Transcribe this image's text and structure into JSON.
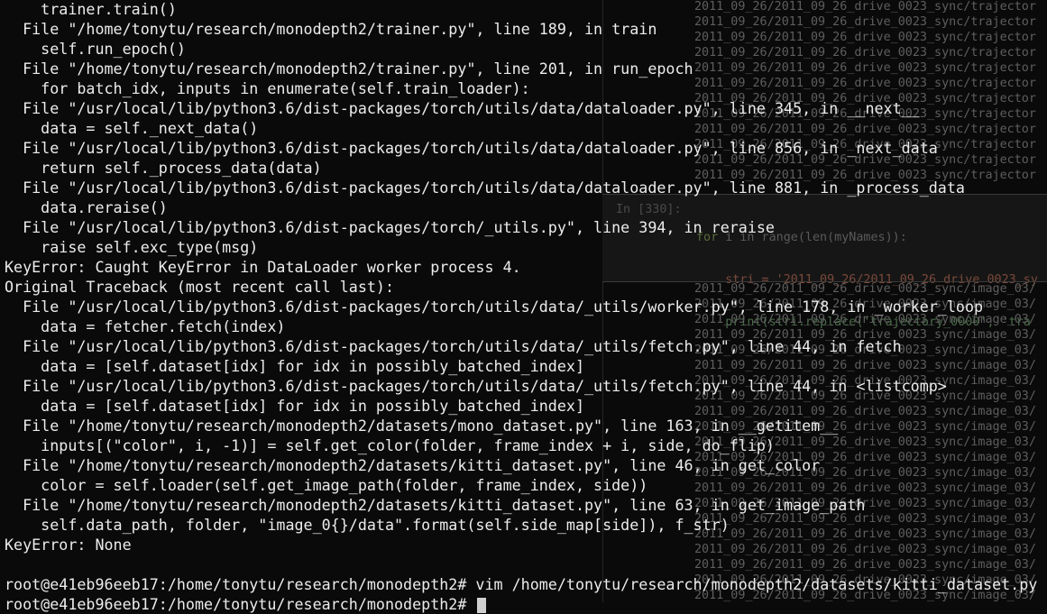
{
  "background_window": {
    "upper_lines": [
      "2011_09_26/2011_09_26_drive_0023_sync/trajector",
      "2011_09_26/2011_09_26_drive_0023_sync/trajector",
      "2011_09_26/2011_09_26_drive_0023_sync/trajector",
      "2011_09_26/2011_09_26_drive_0023_sync/trajector",
      "2011_09_26/2011_09_26_drive_0023_sync/trajector",
      "2011_09_26/2011_09_26_drive_0023_sync/trajector",
      "2011_09_26/2011_09_26_drive_0023_sync/trajector",
      "2011_09_26/2011_09_26_drive_0023_sync/trajector",
      "2011_09_26/2011_09_26_drive_0023_sync/trajector",
      "2011_09_26/2011_09_26_drive_0023_sync/trajector",
      "2011_09_26/2011_09_26_drive_0023_sync/trajector",
      "2011_09_26/2011_09_26_drive_0023_sync/trajector"
    ],
    "cell_prompt": "In [330]:",
    "code_line_1_kw": "for",
    "code_line_1_rest": " i in range(len(myNames)):",
    "code_line_2": "    stri = '2011_09_26/2011_09_26_drive_0023_sy",
    "code_line_3": "    print(stri.replace('trajectory_0000', 'tra",
    "lower_lines": [
      "2011_09_26/2011_09_26_drive_0023_sync/image_03/",
      "2011_09_26/2011_09_26_drive_0023_sync/image_03/",
      "2011_09_26/2011_09_26_drive_0023_sync/image_03/",
      "2011_09_26/2011_09_26_drive_0023_sync/image_03/",
      "2011_09_26/2011_09_26_drive_0023_sync/image_03/",
      "2011_09_26/2011_09_26_drive_0023_sync/image_03/",
      "2011_09_26/2011_09_26_drive_0023_sync/image_03/",
      "2011_09_26/2011_09_26_drive_0023_sync/image_03/",
      "2011_09_26/2011_09_26_drive_0023_sync/image_03/",
      "2011_09_26/2011_09_26_drive_0023_sync/image_03/",
      "2011_09_26/2011_09_26_drive_0023_sync/image_03/",
      "2011_09_26/2011_09_26_drive_0023_sync/image_03/",
      "2011_09_26/2011_09_26_drive_0023_sync/image_03/",
      "2011_09_26/2011_09_26_drive_0023_sync/image_03/",
      "2011_09_26/2011_09_26_drive_0023_sync/image_03/",
      "2011_09_26/2011_09_26_drive_0023_sync/image_03/",
      "2011_09_26/2011_09_26_drive_0023_sync/image_03/",
      "2011_09_26/2011_09_26_drive_0023_sync/image_03/",
      "2011_09_26/2011_09_26_drive_0023_sync/image_03/",
      "2011_09_26/2011_09_26_drive_0023_sync/image_03/",
      "2011_09_26/2011_09_26_drive_0023_sync/image_03/"
    ]
  },
  "terminal": {
    "lines": [
      "  trainer.train()",
      "File \"/home/tonytu/research/monodepth2/trainer.py\", line 189, in train",
      "  self.run_epoch()",
      "File \"/home/tonytu/research/monodepth2/trainer.py\", line 201, in run_epoch",
      "  for batch_idx, inputs in enumerate(self.train_loader):",
      "File \"/usr/local/lib/python3.6/dist-packages/torch/utils/data/dataloader.py\", line 345, in __next__",
      "  data = self._next_data()",
      "File \"/usr/local/lib/python3.6/dist-packages/torch/utils/data/dataloader.py\", line 856, in _next_data",
      "  return self._process_data(data)",
      "File \"/usr/local/lib/python3.6/dist-packages/torch/utils/data/dataloader.py\", line 881, in _process_data",
      "  data.reraise()",
      "File \"/usr/local/lib/python3.6/dist-packages/torch/_utils.py\", line 394, in reraise",
      "  raise self.exc_type(msg)",
      "KeyError: Caught KeyError in DataLoader worker process 4.",
      "Original Traceback (most recent call last):",
      "File \"/usr/local/lib/python3.6/dist-packages/torch/utils/data/_utils/worker.py\", line 178, in _worker_loop",
      "  data = fetcher.fetch(index)",
      "File \"/usr/local/lib/python3.6/dist-packages/torch/utils/data/_utils/fetch.py\", line 44, in fetch",
      "  data = [self.dataset[idx] for idx in possibly_batched_index]",
      "File \"/usr/local/lib/python3.6/dist-packages/torch/utils/data/_utils/fetch.py\", line 44, in <listcomp>",
      "  data = [self.dataset[idx] for idx in possibly_batched_index]",
      "File \"/home/tonytu/research/monodepth2/datasets/mono_dataset.py\", line 163, in __getitem__",
      "  inputs[(\"color\", i, -1)] = self.get_color(folder, frame_index + i, side, do_flip)",
      "File \"/home/tonytu/research/monodepth2/datasets/kitti_dataset.py\", line 46, in get_color",
      "  color = self.loader(self.get_image_path(folder, frame_index, side))",
      "File \"/home/tonytu/research/monodepth2/datasets/kitti_dataset.py\", line 63, in get_image_path",
      "  self.data_path, folder, \"image_0{}/data\".format(self.side_map[side]), f_str)",
      "KeyError: None",
      "",
      "root@e41eb96eeb17:/home/tonytu/research/monodepth2# vim /home/tonytu/research/monodepth2/datasets/kitti_dataset.py"
    ],
    "indent_flags": [
      1,
      1,
      1,
      1,
      1,
      1,
      1,
      1,
      1,
      1,
      1,
      1,
      1,
      0,
      0,
      1,
      1,
      1,
      1,
      1,
      1,
      1,
      1,
      1,
      1,
      1,
      1,
      0,
      0,
      0
    ],
    "prompt": "root@e41eb96eeb17:/home/tonytu/research/monodepth2# "
  }
}
